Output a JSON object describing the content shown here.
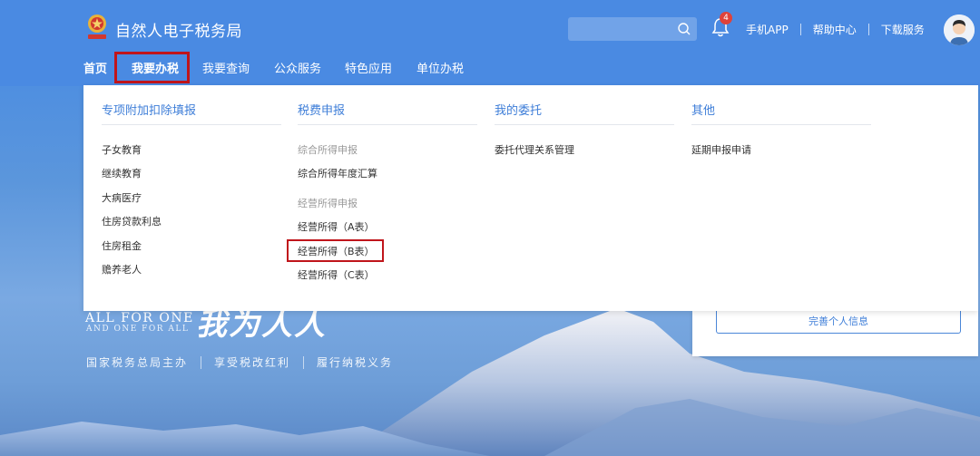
{
  "header": {
    "site_title": "自然人电子税务局",
    "notification_count": "4",
    "links": [
      "手机APP",
      "帮助中心",
      "下载服务"
    ],
    "search_placeholder": ""
  },
  "nav": {
    "items": [
      "首页",
      "我要办税",
      "我要查询",
      "公众服务",
      "特色应用",
      "单位办税"
    ],
    "active": "我要办税"
  },
  "menu": {
    "col1": {
      "title": "专项附加扣除填报",
      "items": [
        "子女教育",
        "继续教育",
        "大病医疗",
        "住房贷款利息",
        "住房租金",
        "赡养老人"
      ]
    },
    "col2": {
      "title": "税费申报",
      "group1_title": "综合所得申报",
      "group1_items": [
        "综合所得年度汇算"
      ],
      "group2_title": "经营所得申报",
      "group2_items": [
        "经营所得（A表）",
        "经营所得（B表）",
        "经营所得（C表）"
      ]
    },
    "col3": {
      "title": "我的委托",
      "items": [
        "委托代理关系管理"
      ]
    },
    "col4": {
      "title": "其他",
      "items": [
        "延期申报申请"
      ]
    }
  },
  "hero": {
    "en_line1": "ALL FOR ONE",
    "en_line2": "AND ONE FOR ALL",
    "calligraphy": "我为人人",
    "slogans": [
      "国家税务总局主办",
      "享受税改红利",
      "履行纳税义务"
    ]
  },
  "card": {
    "button_label": "完善个人信息"
  },
  "colors": {
    "brand_blue": "#4a8ae2",
    "link_blue": "#3e7ed8",
    "highlight_red": "#c0151b"
  }
}
